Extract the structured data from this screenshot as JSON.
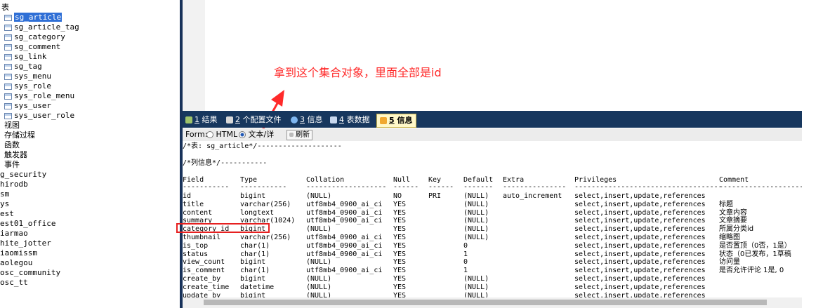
{
  "tree": {
    "tables_label": "表",
    "tables": [
      "sg_article",
      "sg_article_tag",
      "sg_category",
      "sg_comment",
      "sg_link",
      "sg_tag",
      "sys_menu",
      "sys_role",
      "sys_role_menu",
      "sys_user",
      "sys_user_role"
    ],
    "selected_index": 0,
    "folders": [
      "视图",
      "存储过程",
      "函数",
      "触发器",
      "事件"
    ],
    "databases": [
      "g_security",
      "hirodb",
      "sm",
      "ys",
      "est",
      "est01_office",
      "iarmao",
      "hite_jotter",
      "iaomissm",
      "aolegou",
      "osc_community",
      "osc_tt"
    ]
  },
  "tabs": [
    {
      "num": "1",
      "label": "结果"
    },
    {
      "num": "2",
      "label": "个配置文件"
    },
    {
      "num": "3",
      "label": "信息"
    },
    {
      "num": "4",
      "label": "表数据"
    },
    {
      "num": "5",
      "label": "信息"
    }
  ],
  "form": {
    "format_label": "Form:",
    "html_label": "HTML",
    "text_label": "文本/详",
    "refresh_label": "刷新"
  },
  "info": {
    "table_line": "/*表:  sg_article*/--------------------",
    "columns_line": "/*列信息*/-----------",
    "headers": [
      "Field",
      "Type",
      "Collation",
      "Null",
      "Key",
      "Default",
      "Extra",
      "Privileges",
      "Comment"
    ],
    "underlines": [
      "-----------",
      "-----------",
      "-------------------",
      "------",
      "------",
      "-------",
      "---------------",
      "-----------------------------------",
      "---------------------"
    ],
    "rows": [
      [
        "id",
        "bigint",
        "(NULL)",
        "NO",
        "PRI",
        "(NULL)",
        "auto_increment",
        "select,insert,update,references",
        ""
      ],
      [
        "title",
        "varchar(256)",
        "utf8mb4_0900_ai_ci",
        "YES",
        "",
        "(NULL)",
        "",
        "select,insert,update,references",
        "标题"
      ],
      [
        "content",
        "longtext",
        "utf8mb4_0900_ai_ci",
        "YES",
        "",
        "(NULL)",
        "",
        "select,insert,update,references",
        "文章内容"
      ],
      [
        "summary",
        "varchar(1024)",
        "utf8mb4_0900_ai_ci",
        "YES",
        "",
        "(NULL)",
        "",
        "select,insert,update,references",
        "文章摘要"
      ],
      [
        "category_id",
        "bigint",
        "(NULL)",
        "YES",
        "",
        "(NULL)",
        "",
        "select,insert,update,references",
        "所属分类id"
      ],
      [
        "thumbnail",
        "varchar(256)",
        "utf8mb4_0900_ai_ci",
        "YES",
        "",
        "(NULL)",
        "",
        "select,insert,update,references",
        "缩略图"
      ],
      [
        "is_top",
        "char(1)",
        "utf8mb4_0900_ai_ci",
        "YES",
        "",
        "0",
        "",
        "select,insert,update,references",
        "是否置顶（0否，1是）"
      ],
      [
        "status",
        "char(1)",
        "utf8mb4_0900_ai_ci",
        "YES",
        "",
        "1",
        "",
        "select,insert,update,references",
        "状态（0已发布，1草稿"
      ],
      [
        "view_count",
        "bigint",
        "(NULL)",
        "YES",
        "",
        "0",
        "",
        "select,insert,update,references",
        "访问量"
      ],
      [
        "is_comment",
        "char(1)",
        "utf8mb4_0900_ai_ci",
        "YES",
        "",
        "1",
        "",
        "select,insert,update,references",
        "是否允许评论 1是, 0"
      ],
      [
        "create_by",
        "bigint",
        "(NULL)",
        "YES",
        "",
        "(NULL)",
        "",
        "select,insert,update,references",
        ""
      ],
      [
        "create_time",
        "datetime",
        "(NULL)",
        "YES",
        "",
        "(NULL)",
        "",
        "select,insert,update,references",
        ""
      ],
      [
        "update_by",
        "bigint",
        "(NULL)",
        "YES",
        "",
        "(NULL)",
        "",
        "select,insert,update,references",
        ""
      ]
    ]
  },
  "annotation": "拿到这个集合对象，里面全部是id",
  "colors": {
    "annotation": "#ff2a2a",
    "tabbar": "#17375e",
    "selection": "#2f6fd6"
  }
}
